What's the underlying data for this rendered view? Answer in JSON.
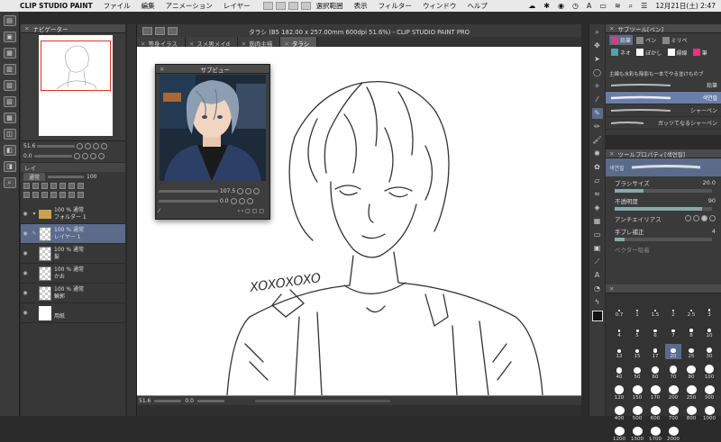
{
  "menubar": {
    "app_name": "CLIP STUDIO PAINT",
    "items": [
      "ファイル",
      "編集",
      "アニメーション",
      "レイヤー",
      "選択範囲",
      "表示",
      "フィルター",
      "ウィンドウ",
      "ヘルプ"
    ],
    "datetime": "12月21日(土) 2:47"
  },
  "navigator": {
    "title": "ナビゲーター"
  },
  "nav_controls": {
    "zoom": "51.6",
    "angle": "0.0"
  },
  "layer_panel": {
    "tab": "レイ",
    "blend_mode": "通常",
    "opacity": "100",
    "layers": [
      {
        "line1": "100 % 通常",
        "line2": "フォルダー 1"
      },
      {
        "line1": "100 % 通常",
        "line2": "レイヤー 1"
      },
      {
        "line1": "100 % 通常",
        "line2": "髪"
      },
      {
        "line1": "100 % 通常",
        "line2": "かお"
      },
      {
        "line1": "100 % 通常",
        "line2": "輪郭"
      },
      {
        "line1": "",
        "line2": "用紙"
      }
    ]
  },
  "document": {
    "window_title": "タラシ (B5 182.00 x 257.00mm 600dpi 51.6%) - CLIP STUDIO PAINT PRO",
    "tabs": [
      "等身イラス",
      "スメ男メイd",
      "筋肉主描",
      "タラシ"
    ],
    "active_tab": "タラシ",
    "canvas_text": "XOXOXOXO",
    "status_zoom": "51.6",
    "status_angle": "0.0"
  },
  "subview": {
    "title": "サブビュー",
    "zoom": "107.5",
    "angle": "0.0"
  },
  "subtool": {
    "title": "サブツール[ペン]",
    "groups": [
      [
        "鉛筆",
        "ペン",
        "ミリペ"
      ],
      [
        "ネオ",
        "ぼかし",
        "縁線",
        "筆"
      ]
    ],
    "description": "主線も水彩も陰影も一本でやる並けものブ",
    "brushes": [
      "鉛筆",
      "색연필",
      "シャーペン",
      "ガッツてなるシャーペン"
    ],
    "selected_brush": "색연필"
  },
  "tool_property": {
    "title": "ツールプロパティ[색연필]",
    "brush_name": "색연필",
    "brush_size_label": "ブラシサイズ",
    "brush_size": "20.0",
    "opacity_label": "不透明度",
    "opacity": "90",
    "antialias_label": "アンチエイリアス",
    "stabilization_label": "手ブレ補正",
    "stabilization": "4",
    "vector_label": "ベクター吸着"
  },
  "brush_sizes": [
    "0.7",
    "1",
    "1.5",
    "2",
    "2.5",
    "3",
    "4",
    "5",
    "6",
    "7",
    "8",
    "10",
    "12",
    "15",
    "17",
    "20",
    "25",
    "30",
    "40",
    "50",
    "60",
    "70",
    "80",
    "100",
    "120",
    "150",
    "170",
    "200",
    "250",
    "300",
    "400",
    "500",
    "600",
    "700",
    "800",
    "1000",
    "1200",
    "1500",
    "1700",
    "2000"
  ],
  "selected_brush_size": "20",
  "colors": {
    "accent": "#5a6b8c",
    "panel": "#3a3a3a",
    "menubar": "#e9e9e9"
  }
}
